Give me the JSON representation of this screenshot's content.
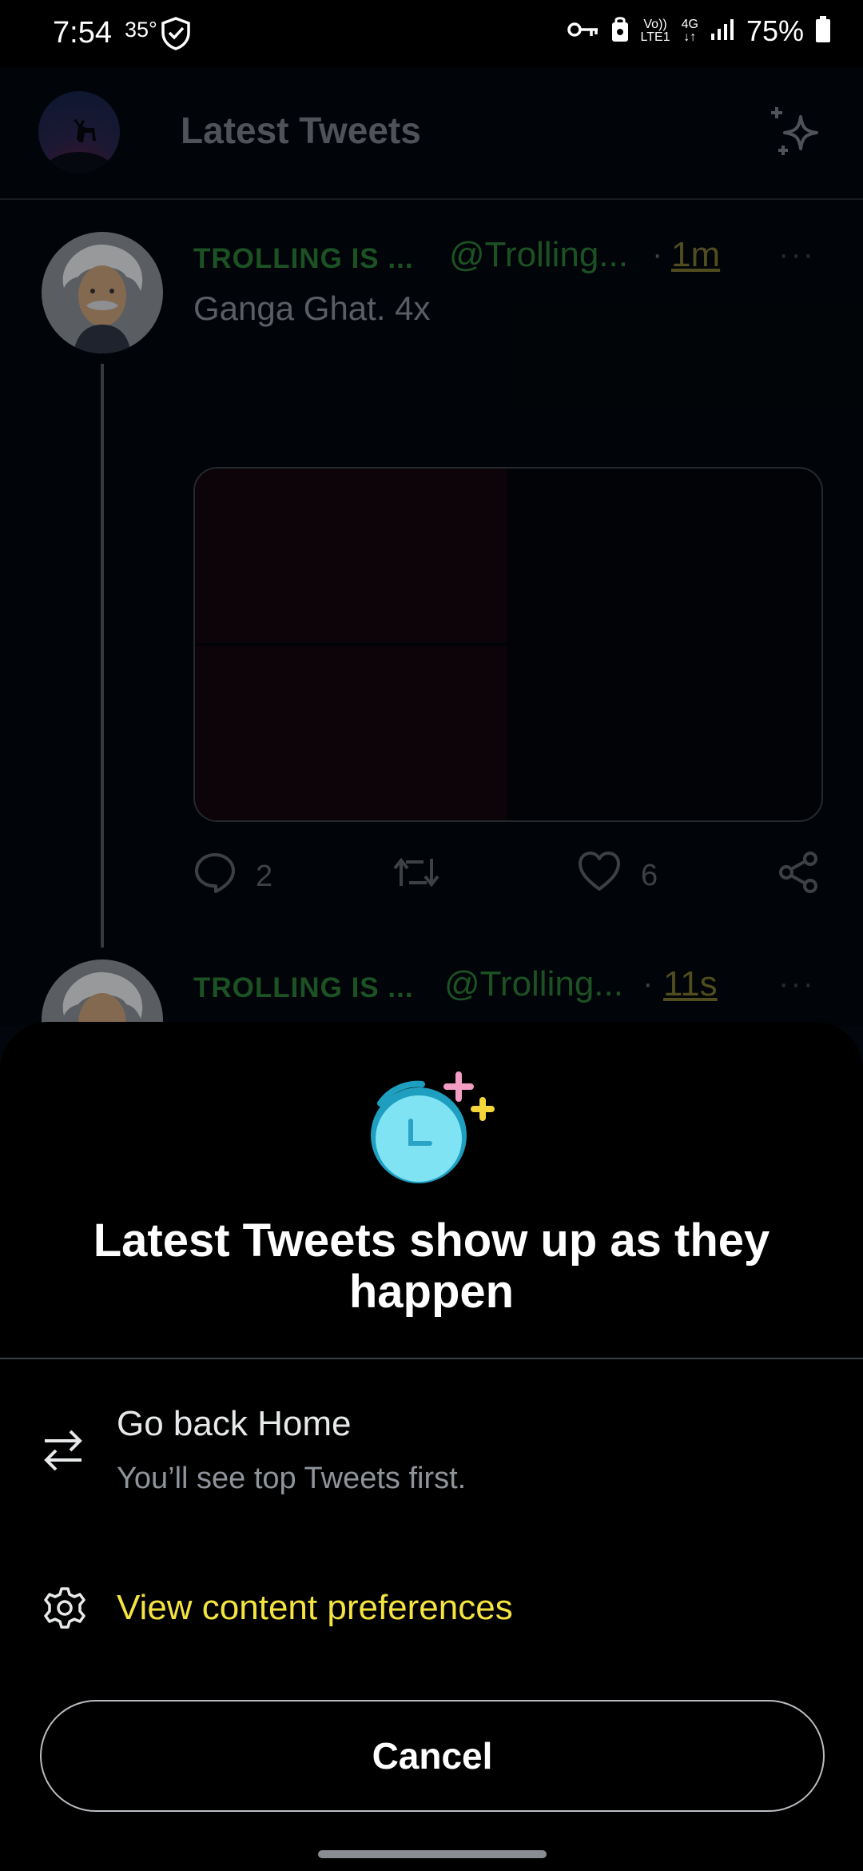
{
  "status_bar": {
    "time": "7:54",
    "temperature": "35°",
    "network_volte": "Vo))",
    "network_lte": "LTE1",
    "network_4g": "4G",
    "battery": "75%"
  },
  "app_bar": {
    "title": "Latest Tweets"
  },
  "tweets": [
    {
      "name": "TROLLING IS ...",
      "handle": "@Trolling...",
      "separator": "·",
      "time": "1m",
      "more": "···",
      "text": "Ganga Ghat. 4x",
      "replies": "2",
      "retweets": "",
      "likes": "6"
    },
    {
      "name": "TROLLING IS ...",
      "handle": "@Trolling...",
      "separator": "·",
      "time": "11s",
      "more": "···"
    }
  ],
  "sheet": {
    "title": "Latest Tweets show up as they happen",
    "home_option": {
      "title": "Go back Home",
      "subtitle": "You’ll see top Tweets first."
    },
    "preferences_option": {
      "label": "View content preferences"
    },
    "cancel_label": "Cancel"
  },
  "colors": {
    "accent_yellow": "#f4e340",
    "handle_green": "#2c7d38",
    "sheet_bg": "#000000",
    "feed_bg": "#03070d"
  },
  "icons": {
    "shield": "shield-check-icon",
    "key": "key-icon",
    "sparkle": "sparkle-icon",
    "reply": "reply-icon",
    "retweet": "retweet-icon",
    "like": "heart-icon",
    "share": "share-icon",
    "clock": "clock-sparkle-icon",
    "swap": "swap-arrows-icon",
    "settings": "gear-icon"
  }
}
